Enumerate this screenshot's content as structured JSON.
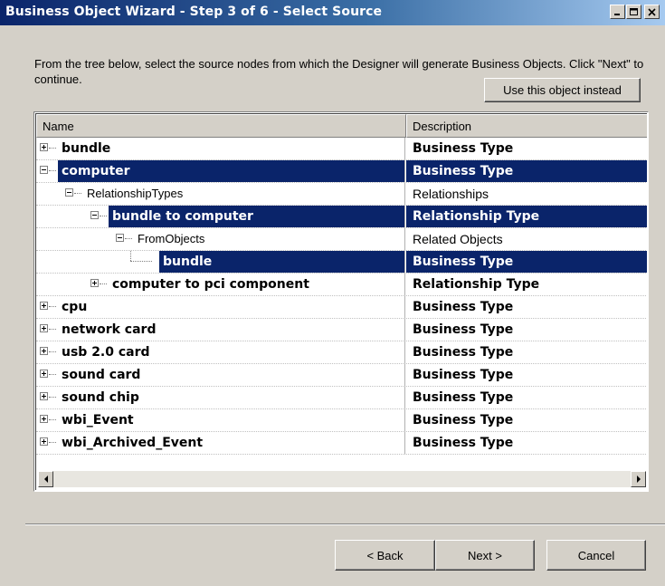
{
  "window": {
    "title": "Business Object Wizard - Step 3 of 6 - Select Source",
    "titlebar_colors": [
      "#0a246a",
      "#a6caf0"
    ]
  },
  "intro_text": "From the tree below, select the source nodes from which the Designer will generate Business Objects. Click \"Next\" to continue.",
  "use_object_button": "Use this object instead",
  "tree": {
    "columns": [
      "Name",
      "Description"
    ],
    "rows": [
      {
        "name": "bundle",
        "description": "Business Type",
        "level": 0,
        "expander": "plus",
        "bold": true,
        "selected": false
      },
      {
        "name": "computer",
        "description": "Business Type",
        "level": 0,
        "expander": "minus",
        "bold": true,
        "selected": true
      },
      {
        "name": "RelationshipTypes",
        "description": "Relationships",
        "level": 1,
        "expander": "minus",
        "bold": false,
        "selected": false
      },
      {
        "name": "bundle to computer",
        "description": "Relationship Type",
        "level": 2,
        "expander": "minus",
        "bold": true,
        "selected": true
      },
      {
        "name": "FromObjects",
        "description": "Related Objects",
        "level": 3,
        "expander": "minus",
        "bold": false,
        "selected": false
      },
      {
        "name": "bundle",
        "description": "Business Type",
        "level": 4,
        "expander": "none",
        "bold": true,
        "selected": true
      },
      {
        "name": "computer to pci component",
        "description": "Relationship Type",
        "level": 2,
        "expander": "plus",
        "bold": true,
        "selected": false
      },
      {
        "name": "cpu",
        "description": "Business Type",
        "level": 0,
        "expander": "plus",
        "bold": true,
        "selected": false
      },
      {
        "name": "network card",
        "description": "Business Type",
        "level": 0,
        "expander": "plus",
        "bold": true,
        "selected": false
      },
      {
        "name": "usb 2.0 card",
        "description": "Business Type",
        "level": 0,
        "expander": "plus",
        "bold": true,
        "selected": false
      },
      {
        "name": "sound card",
        "description": "Business Type",
        "level": 0,
        "expander": "plus",
        "bold": true,
        "selected": false
      },
      {
        "name": "sound chip",
        "description": "Business Type",
        "level": 0,
        "expander": "plus",
        "bold": true,
        "selected": false
      },
      {
        "name": "wbi_Event",
        "description": "Business Type",
        "level": 0,
        "expander": "plus",
        "bold": true,
        "selected": false
      },
      {
        "name": "wbi_Archived_Event",
        "description": "Business Type",
        "level": 0,
        "expander": "plus",
        "bold": true,
        "selected": false
      }
    ]
  },
  "buttons": {
    "back": "< Back",
    "next": "Next >",
    "cancel": "Cancel"
  },
  "icons": [
    "minimize-icon",
    "maximize-icon",
    "close-icon",
    "scroll-left-icon",
    "scroll-right-icon"
  ],
  "colors": {
    "selection": "#0a246a",
    "dialog": "#d4d0c8"
  }
}
